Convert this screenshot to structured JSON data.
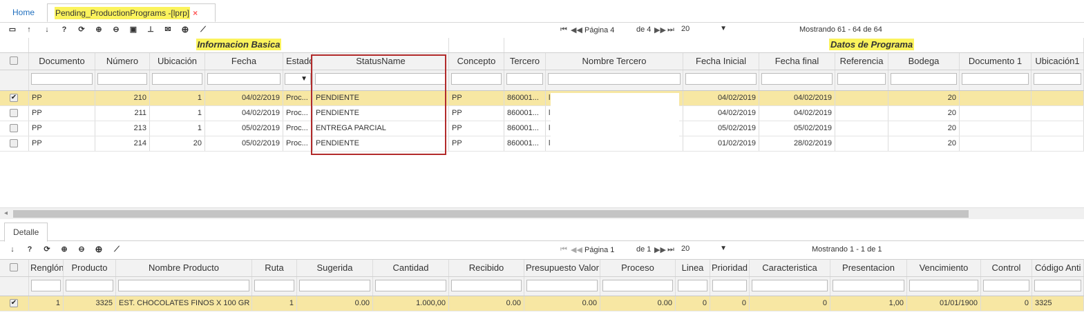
{
  "tabs": {
    "home": "Home",
    "active": "Pending_ProductionPrograms -[lprp]",
    "close": "×"
  },
  "top_toolbar": {
    "icons": [
      "move-icon",
      "arrow-up-icon",
      "arrow-down-icon",
      "help-icon",
      "refresh-icon",
      "zoom-in-icon",
      "zoom-out-icon",
      "comment-icon",
      "pin-icon",
      "mail-icon",
      "add-circle-icon",
      "resize-icon"
    ],
    "icon_glyphs": [
      "▭",
      "↑",
      "↓",
      "?",
      "⟳",
      "⊕",
      "⊖",
      "▣",
      "⊥",
      "✉",
      "⊕",
      "⟋"
    ],
    "pager": {
      "first": "⏮",
      "prev": "◀◀",
      "page_label": "Página 4",
      "of_label": "de 4",
      "next": "▶▶",
      "last": "⏭",
      "page_size": "20",
      "showing": "Mostrando 61 - 64 de 64"
    }
  },
  "groups": {
    "basic": "Informacion Basica",
    "program": "Datos de Programa"
  },
  "main_grid": {
    "columns": [
      "Documento",
      "Número",
      "Ubicación",
      "Fecha",
      "Estado",
      "StatusName",
      "Concepto",
      "Tercero",
      "Nombre Tercero",
      "Fecha Inicial",
      "Fecha final",
      "Referencia",
      "Bodega",
      "Documento 1",
      "Ubicación1"
    ],
    "rows": [
      {
        "checked": "✔",
        "documento": "PP",
        "numero": "210",
        "ubicacion": "1",
        "fecha": "04/02/2019",
        "estado": "Proc...",
        "status": "PENDIENTE",
        "concepto": "PP",
        "tercero": "860001...",
        "nombre": "l",
        "fecha_ini": "04/02/2019",
        "fecha_fin": "04/02/2019",
        "referencia": "",
        "bodega": "20",
        "doc1": "",
        "ubic1": ""
      },
      {
        "checked": "",
        "documento": "PP",
        "numero": "211",
        "ubicacion": "1",
        "fecha": "04/02/2019",
        "estado": "Proc...",
        "status": "PENDIENTE",
        "concepto": "PP",
        "tercero": "860001...",
        "nombre": "l",
        "fecha_ini": "04/02/2019",
        "fecha_fin": "04/02/2019",
        "referencia": "",
        "bodega": "20",
        "doc1": "",
        "ubic1": ""
      },
      {
        "checked": "",
        "documento": "PP",
        "numero": "213",
        "ubicacion": "1",
        "fecha": "05/02/2019",
        "estado": "Proc...",
        "status": "ENTREGA PARCIAL",
        "concepto": "PP",
        "tercero": "860001...",
        "nombre": "l",
        "fecha_ini": "05/02/2019",
        "fecha_fin": "05/02/2019",
        "referencia": "",
        "bodega": "20",
        "doc1": "",
        "ubic1": ""
      },
      {
        "checked": "",
        "documento": "PP",
        "numero": "214",
        "ubicacion": "20",
        "fecha": "05/02/2019",
        "estado": "Proc...",
        "status": "PENDIENTE",
        "concepto": "PP",
        "tercero": "860001...",
        "nombre": "l",
        "fecha_ini": "01/02/2019",
        "fecha_fin": "28/02/2019",
        "referencia": "",
        "bodega": "20",
        "doc1": "",
        "ubic1": ""
      }
    ],
    "estado_filter_arrow": "▼"
  },
  "detail_tab": "Detalle",
  "detail_toolbar": {
    "icons": [
      "arrow-down-icon",
      "help-icon",
      "refresh-icon",
      "zoom-in-icon",
      "zoom-out-icon",
      "add-circle-icon",
      "resize-icon"
    ],
    "icon_glyphs": [
      "↓",
      "?",
      "⟳",
      "⊕",
      "⊖",
      "⊕",
      "⟋"
    ],
    "pager": {
      "first": "⏮",
      "prev": "◀◀",
      "page_label": "Página 1",
      "of_label": "de 1",
      "next": "▶▶",
      "last": "⏭",
      "page_size": "20",
      "showing": "Mostrando 1 - 1 de 1"
    }
  },
  "detail_grid": {
    "columns": [
      "Renglón",
      "Producto",
      "Nombre Producto",
      "Ruta",
      "Sugerida",
      "Cantidad",
      "Recibido",
      "Presupuesto Valor",
      "Proceso",
      "Linea",
      "Prioridad",
      "Caracteristica",
      "Presentacion",
      "Vencimiento",
      "Control",
      "Código Anti"
    ],
    "rows": [
      {
        "checked": "✔",
        "renglon": "1",
        "producto": "3325",
        "nombre": "EST. CHOCOLATES FINOS X 100 GR",
        "ruta": "1",
        "sugerida": "0.00",
        "cantidad": "1.000,00",
        "recibido": "0.00",
        "presupuesto": "0.00",
        "proceso": "0.00",
        "linea": "0",
        "prioridad": "0",
        "caracteristica": "0",
        "presentacion": "1,00",
        "vencimiento": "01/01/1900",
        "control": "0",
        "codigo": "3325"
      }
    ]
  },
  "scroll_left": "◂"
}
